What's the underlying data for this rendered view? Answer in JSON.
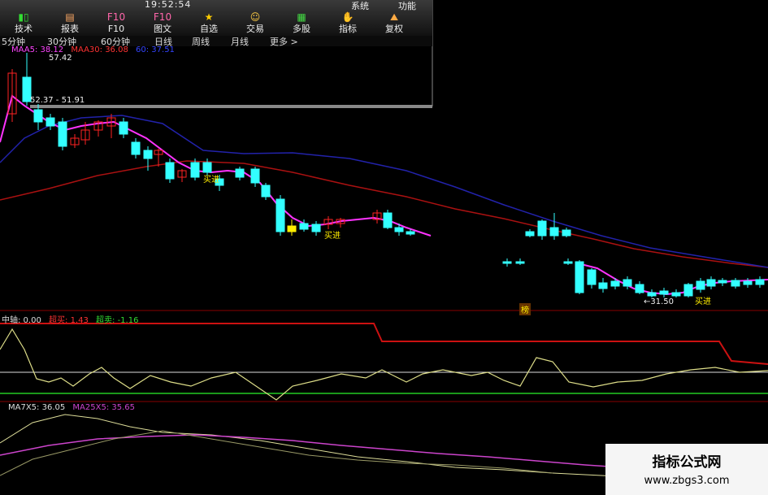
{
  "status_bar": {
    "time": "19:52:54",
    "system": "系统",
    "function": "功能"
  },
  "toolbar": [
    {
      "label": "技术",
      "icon": "candlestick-icon"
    },
    {
      "label": "报表",
      "icon": "report-icon"
    },
    {
      "label": "F10",
      "icon": "f10-icon"
    },
    {
      "label": "图文",
      "icon": "graphic-text-icon"
    },
    {
      "label": "自选",
      "icon": "favorite-icon"
    },
    {
      "label": "交易",
      "icon": "trade-icon"
    },
    {
      "label": "多股",
      "icon": "multi-stock-icon"
    },
    {
      "label": "指标",
      "icon": "indicator-icon"
    },
    {
      "label": "复权",
      "icon": "rights-restore-icon"
    }
  ],
  "periods": [
    "5分钟",
    "30分钟",
    "60分钟",
    "日线",
    "周线",
    "月线",
    "更多 >"
  ],
  "ma_legend": [
    {
      "text": "MAA5: 38.12",
      "color": "#ff44ff"
    },
    {
      "text": "MAA30: 36.08",
      "color": "#ff3333"
    },
    {
      "text": "60: 37.51",
      "color": "#3344ff"
    }
  ],
  "price_labels": {
    "high": "57.42",
    "range": "52.37 - 51.91",
    "low": "←31.50"
  },
  "signals": [
    "买进",
    "买进",
    "买进"
  ],
  "osc_legend": [
    {
      "text": "中轴: 0.00",
      "color": "#dddddd"
    },
    {
      "text": "超买: 1.43",
      "color": "#ff3333"
    },
    {
      "text": "超卖: -1.16",
      "color": "#33dd33"
    }
  ],
  "ma_sub_legend": [
    {
      "text": "MA7X5: 36.05",
      "color": "#dddddd"
    },
    {
      "text": "MA25X5: 35.65",
      "color": "#cc44cc"
    }
  ],
  "marker_label": "榜",
  "watermark": {
    "title": "指标公式网",
    "url": "www.zbgs3.com"
  },
  "colors": {
    "up": "#ff2222",
    "down": "#33ffff",
    "signal": "#ffee00"
  }
}
